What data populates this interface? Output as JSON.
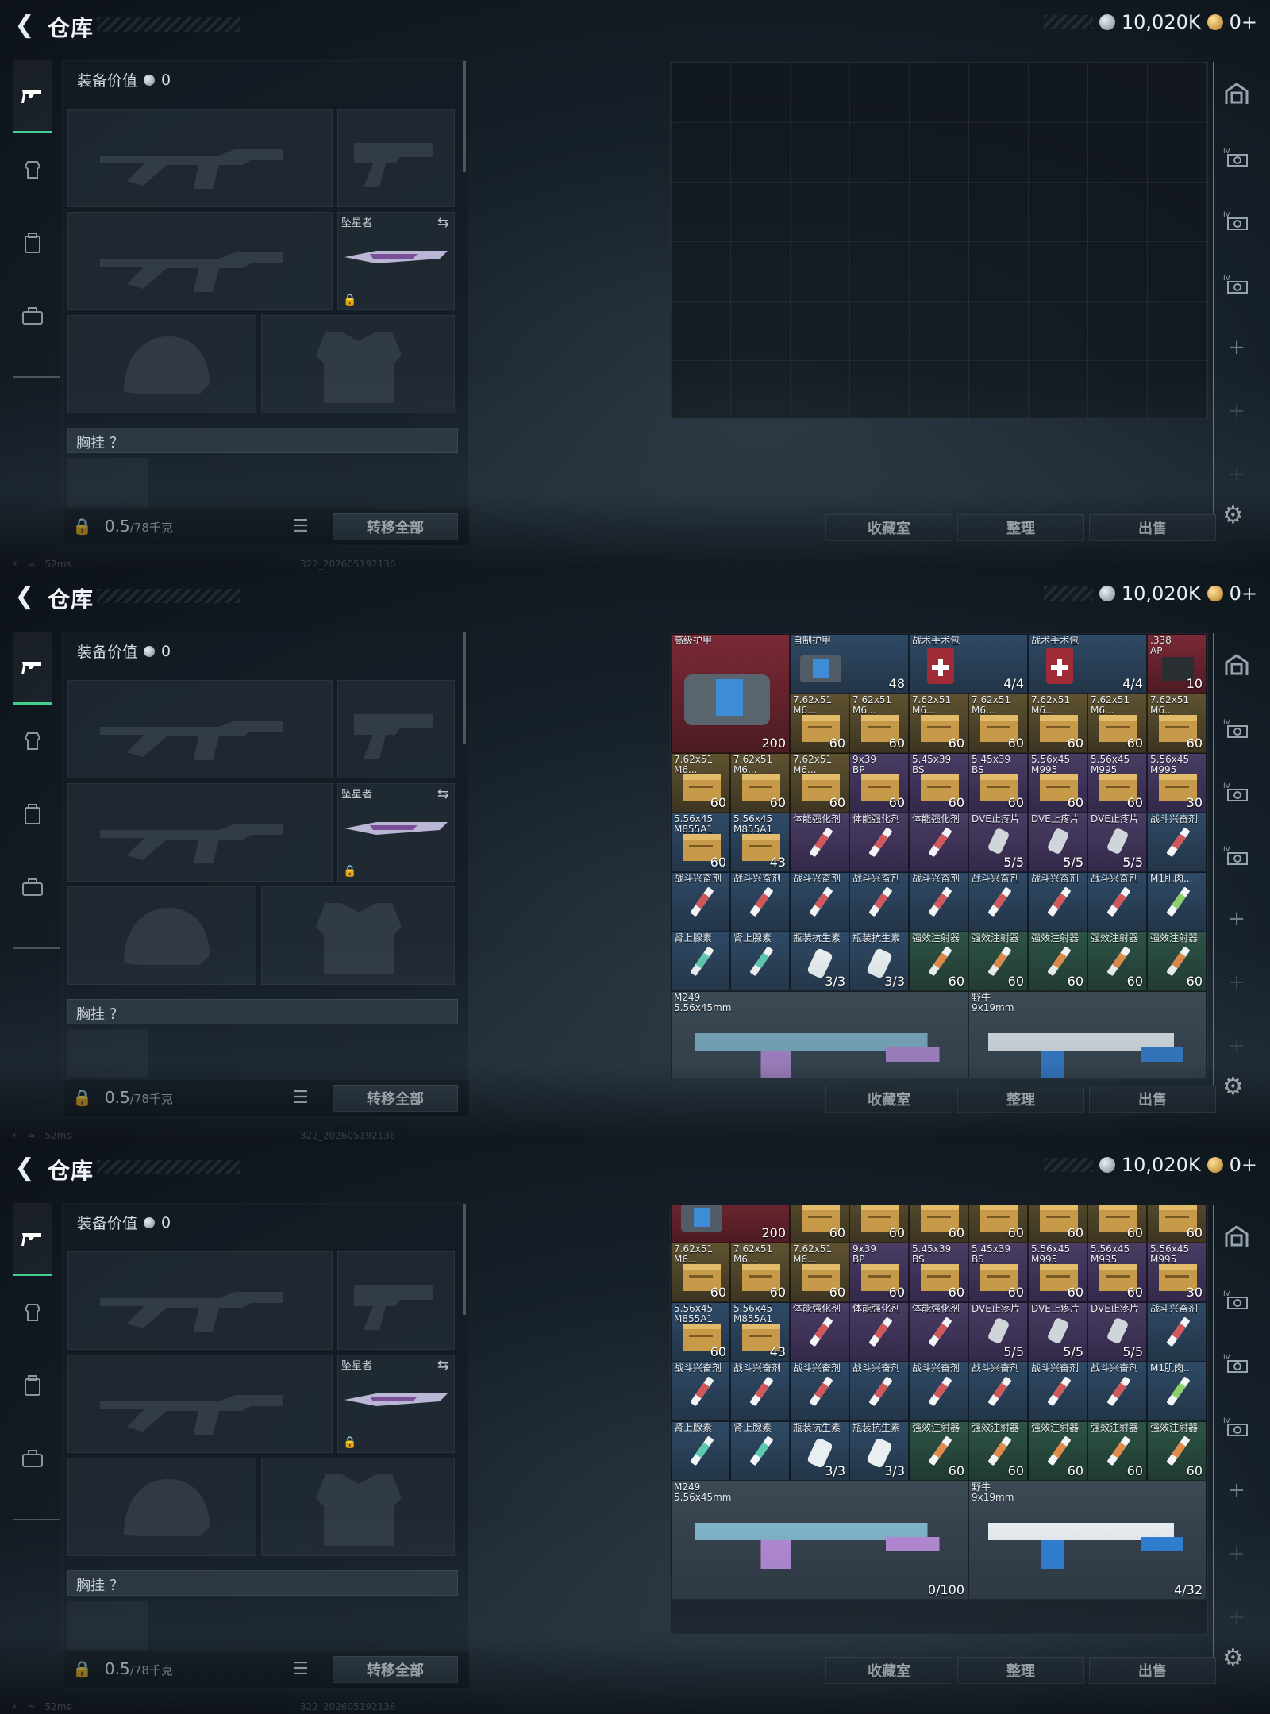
{
  "header": {
    "title": "仓库",
    "silver": "10,020K",
    "gold": "0+"
  },
  "loadout": {
    "equip_value_label": "装备价值",
    "equip_value": "0",
    "melee_label": "坠星者",
    "chest_rig_label": "胸挂 ？",
    "weight_value": "0.5",
    "weight_unit": "/78千克",
    "transfer_all": "转移全部"
  },
  "status": {
    "ping": "52ms",
    "build": "322_202605192136"
  },
  "actions": {
    "collection": "收藏室",
    "sort": "整理",
    "sell": "出售"
  },
  "inventory": {
    "r1": [
      {
        "name": "自制护甲",
        "qty": "48",
        "rarity": "blue"
      },
      {
        "name": "战术手术包",
        "qty": "4/4",
        "rarity": "blue"
      },
      {
        "name": "战术手术包",
        "qty": "4/4",
        "rarity": "blue"
      },
      {
        "name": ".338\nAP",
        "qty": "10",
        "rarity": "red"
      }
    ],
    "big_armor": {
      "name": "高级护甲",
      "qty": "200",
      "rarity": "red"
    },
    "r2": [
      {
        "name": "7.62x51\nM6...",
        "qty": "60",
        "rarity": "gold"
      },
      {
        "name": "7.62x51\nM6...",
        "qty": "60",
        "rarity": "gold"
      },
      {
        "name": "7.62x51\nM6...",
        "qty": "60",
        "rarity": "gold"
      },
      {
        "name": "7.62x51\nM6...",
        "qty": "60",
        "rarity": "gold"
      },
      {
        "name": "7.62x51\nM6...",
        "qty": "60",
        "rarity": "gold"
      },
      {
        "name": "7.62x51\nM6...",
        "qty": "60",
        "rarity": "gold"
      },
      {
        "name": "7.62x51\nM6...",
        "qty": "60",
        "rarity": "gold"
      }
    ],
    "r3": [
      {
        "name": "7.62x51\nM6...",
        "qty": "60",
        "rarity": "gold"
      },
      {
        "name": "7.62x51\nM6...",
        "qty": "60",
        "rarity": "gold"
      },
      {
        "name": "7.62x51\nM6...",
        "qty": "60",
        "rarity": "gold"
      },
      {
        "name": "9x39\nBP",
        "qty": "60",
        "rarity": "purple"
      },
      {
        "name": "5.45x39\nBS",
        "qty": "60",
        "rarity": "purple"
      },
      {
        "name": "5.45x39\nBS",
        "qty": "60",
        "rarity": "purple"
      },
      {
        "name": "5.56x45\nM995",
        "qty": "60",
        "rarity": "purple"
      },
      {
        "name": "5.56x45\nM995",
        "qty": "60",
        "rarity": "purple"
      },
      {
        "name": "5.56x45\nM995",
        "qty": "30",
        "rarity": "purple"
      }
    ],
    "r4": [
      {
        "name": "5.56x45\nM855A1",
        "qty": "60",
        "rarity": "blue"
      },
      {
        "name": "5.56x45\nM855A1",
        "qty": "43",
        "rarity": "blue"
      },
      {
        "name": "体能强化剂",
        "qty": "",
        "rarity": "purple"
      },
      {
        "name": "体能强化剂",
        "qty": "",
        "rarity": "purple"
      },
      {
        "name": "体能强化剂",
        "qty": "",
        "rarity": "purple"
      },
      {
        "name": "DVE止疼片",
        "qty": "5/5",
        "rarity": "purple"
      },
      {
        "name": "DVE止疼片",
        "qty": "5/5",
        "rarity": "purple"
      },
      {
        "name": "DVE止疼片",
        "qty": "5/5",
        "rarity": "purple"
      },
      {
        "name": "战斗兴奋剂",
        "qty": "",
        "rarity": "blue"
      }
    ],
    "r5": [
      {
        "name": "战斗兴奋剂",
        "qty": "",
        "rarity": "blue"
      },
      {
        "name": "战斗兴奋剂",
        "qty": "",
        "rarity": "blue"
      },
      {
        "name": "战斗兴奋剂",
        "qty": "",
        "rarity": "blue"
      },
      {
        "name": "战斗兴奋剂",
        "qty": "",
        "rarity": "blue"
      },
      {
        "name": "战斗兴奋剂",
        "qty": "",
        "rarity": "blue"
      },
      {
        "name": "战斗兴奋剂",
        "qty": "",
        "rarity": "blue"
      },
      {
        "name": "战斗兴奋剂",
        "qty": "",
        "rarity": "blue"
      },
      {
        "name": "战斗兴奋剂",
        "qty": "",
        "rarity": "blue"
      },
      {
        "name": "M1肌肉...",
        "qty": "",
        "rarity": "blue"
      }
    ],
    "r6": [
      {
        "name": "肾上腺素",
        "qty": "",
        "rarity": "blue"
      },
      {
        "name": "肾上腺素",
        "qty": "",
        "rarity": "blue"
      },
      {
        "name": "瓶装抗生素",
        "qty": "3/3",
        "rarity": "blue"
      },
      {
        "name": "瓶装抗生素",
        "qty": "3/3",
        "rarity": "blue"
      },
      {
        "name": "强效注射器",
        "qty": "60",
        "rarity": "green"
      },
      {
        "name": "强效注射器",
        "qty": "60",
        "rarity": "green"
      },
      {
        "name": "强效注射器",
        "qty": "60",
        "rarity": "green"
      },
      {
        "name": "强效注射器",
        "qty": "60",
        "rarity": "green"
      },
      {
        "name": "强效注射器",
        "qty": "60",
        "rarity": "green"
      }
    ],
    "weapons": [
      {
        "name": "M249\n5.56x45mm",
        "qty": "0/100"
      },
      {
        "name": "野牛\n9x19mm",
        "qty": "4/32"
      }
    ]
  },
  "colors": {
    "accent": "#3fd28e",
    "panel": "#141c24"
  }
}
